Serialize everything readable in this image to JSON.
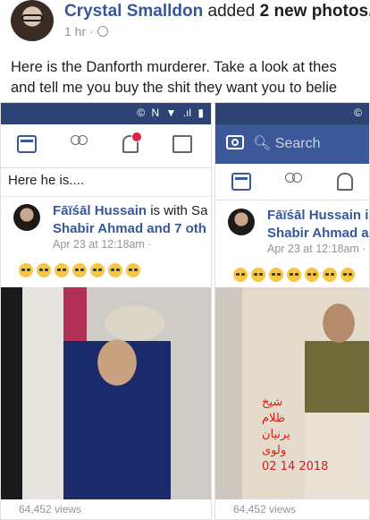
{
  "post": {
    "author": "Crystal Smalldon",
    "action": "added",
    "count_text": "2 new photos.",
    "time": "1 hr ·",
    "text_line1": "Here is the Danforth murderer. Take a look at thes",
    "text_line2": "and tell me you buy the shit they want you to belie"
  },
  "left_screenshot": {
    "status_icons": [
      "©",
      "N",
      "▼",
      ".ıl",
      "▮"
    ],
    "caption": "Here he is....",
    "share_name": "Fāïśāl Hussain",
    "share_with": "is with Sa",
    "share_line2": "Shabir Ahmad and 7 oth",
    "share_date": "Apr 23 at 12:18am ·",
    "emoji_count": 7,
    "views": "64,452 views"
  },
  "right_screenshot": {
    "status_icons": [
      "©"
    ],
    "search_placeholder": "Search",
    "share_name": "Fāïśāl Hussain i",
    "share_line2": "Shabir Ahmad a",
    "share_date": "Apr 23 at 12:18am ·",
    "emoji_count": 7,
    "overlay_text": [
      "شیخ",
      "ظلام",
      "یرنیان",
      "ولوی",
      "02 14 2018"
    ],
    "views": "64,452 views"
  },
  "colors": {
    "fb_blue": "#3b5998",
    "link_blue": "#365899",
    "meta_gray": "#90949c",
    "badge_red": "#e41e3f"
  }
}
